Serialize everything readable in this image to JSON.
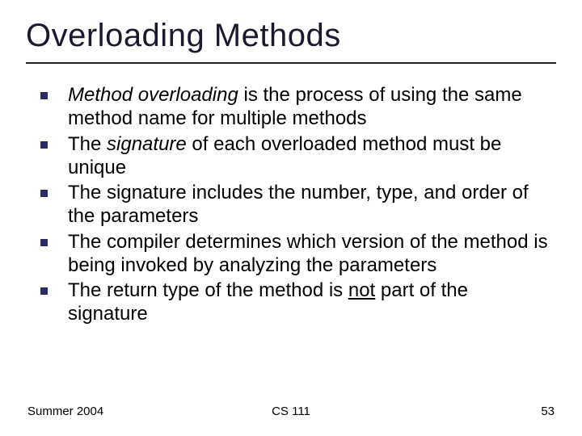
{
  "title": "Overloading Methods",
  "bullets": [
    {
      "lead_italic": "Method overloading",
      "body": " is the process of using the same method name for multiple methods"
    },
    {
      "pre": "The ",
      "mid_italic": "signature",
      "post": " of each overloaded method must be unique"
    },
    {
      "text": "The signature includes the number, type, and order of the parameters"
    },
    {
      "text": "The compiler determines which version of the method is being invoked by analyzing the parameters"
    },
    {
      "pre": "The return type of the method is ",
      "mid_underline": "not",
      "post": " part of the signature"
    }
  ],
  "footer": {
    "left": "Summer 2004",
    "center": "CS 111",
    "right": "53"
  }
}
